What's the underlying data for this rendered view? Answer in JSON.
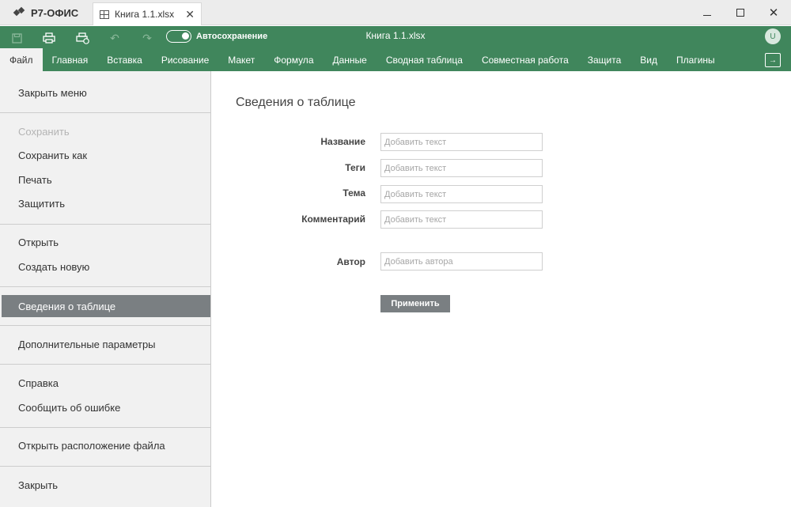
{
  "app": {
    "brand": "Р7-ОФИС",
    "tab_title": "Книга 1.1.xlsx",
    "doc_title": "Книга 1.1.xlsx",
    "autosave_label": "Автосохранение",
    "avatar_initial": "U"
  },
  "menu": {
    "tabs": [
      "Файл",
      "Главная",
      "Вставка",
      "Рисование",
      "Макет",
      "Формула",
      "Данные",
      "Сводная таблица",
      "Совместная работа",
      "Защита",
      "Вид",
      "Плагины"
    ],
    "active_index": 0
  },
  "sidebar": {
    "items": [
      {
        "label": "Закрыть меню"
      },
      {
        "label": "Сохранить"
      },
      {
        "label": "Сохранить как"
      },
      {
        "label": "Печать"
      },
      {
        "label": "Защитить"
      },
      {
        "label": "Открыть"
      },
      {
        "label": "Создать новую"
      },
      {
        "label": "Сведения о таблице"
      },
      {
        "label": "Дополнительные параметры"
      },
      {
        "label": "Справка"
      },
      {
        "label": "Сообщить об ошибке"
      },
      {
        "label": "Открыть расположение файла"
      },
      {
        "label": "Закрыть"
      }
    ]
  },
  "main": {
    "title": "Сведения о таблице",
    "fields": {
      "name": {
        "label": "Название",
        "placeholder": "Добавить текст",
        "value": ""
      },
      "tags": {
        "label": "Теги",
        "placeholder": "Добавить текст",
        "value": ""
      },
      "subject": {
        "label": "Тема",
        "placeholder": "Добавить текст",
        "value": ""
      },
      "comment": {
        "label": "Комментарий",
        "placeholder": "Добавить текст",
        "value": ""
      },
      "author": {
        "label": "Автор",
        "placeholder": "Добавить автора",
        "value": ""
      }
    },
    "apply_label": "Применить"
  },
  "colors": {
    "toolbar_green": "#40865c",
    "active_item_gray": "#7a7f82",
    "sidebar_bg": "#f1f1f1"
  },
  "icons": [
    "save-icon",
    "print-icon",
    "quick-print-icon",
    "undo-icon",
    "redo-icon",
    "spreadsheet-icon",
    "close-icon",
    "exit-icon"
  ]
}
